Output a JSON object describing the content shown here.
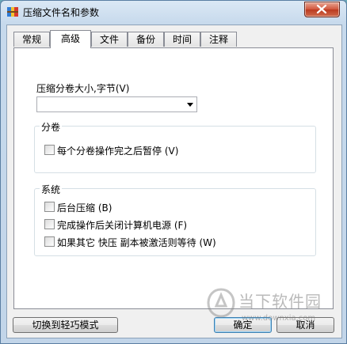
{
  "window": {
    "title": "压缩文件名和参数"
  },
  "tabs": [
    {
      "label": "常规"
    },
    {
      "label": "高级"
    },
    {
      "label": "文件"
    },
    {
      "label": "备份"
    },
    {
      "label": "时间"
    },
    {
      "label": "注释"
    }
  ],
  "active_tab": "高级",
  "split": {
    "size_label": "压缩分卷大小,字节(V)",
    "size_value": "",
    "group_title": "分卷",
    "pause_label": "每个分卷操作完之后暂停 (V)",
    "pause_checked": false
  },
  "system": {
    "group_title": "系统",
    "options": [
      {
        "label": "后台压缩 (B)",
        "checked": false
      },
      {
        "label": "完成操作后关闭计算机电源 (F)",
        "checked": false
      },
      {
        "label": "如果其它 快压 副本被激活则等待 (W)",
        "checked": false
      }
    ]
  },
  "buttons": {
    "light_mode": "切换到轻巧模式",
    "ok": "确定",
    "cancel": "取消"
  },
  "watermark": {
    "text": "当下软件园",
    "url": "www.downxia.com"
  }
}
